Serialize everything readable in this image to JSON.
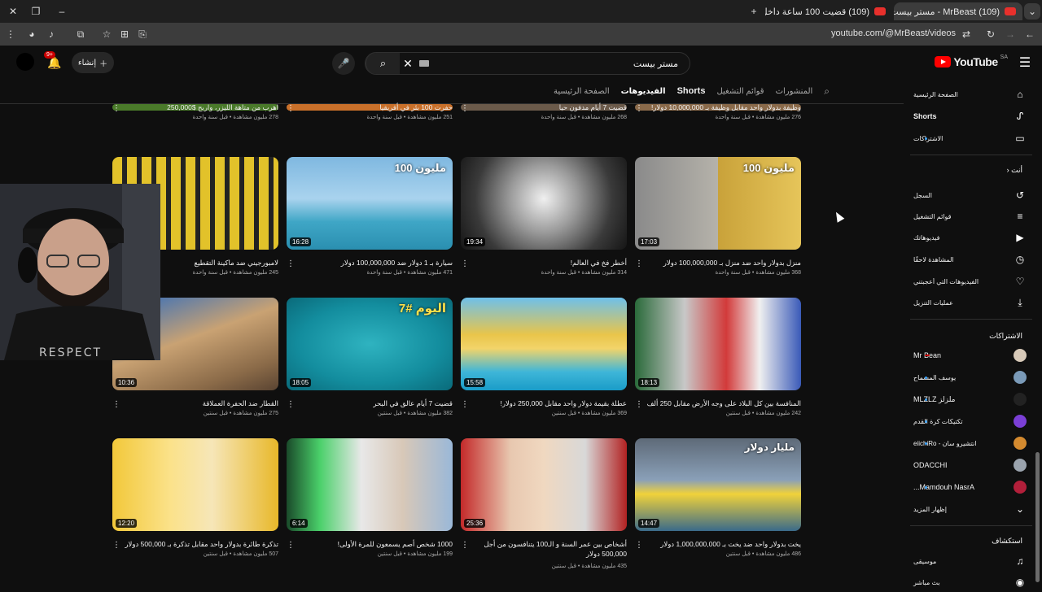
{
  "browser": {
    "tabs": [
      {
        "title": "(109) MrBeast - مستر بيست - Yo",
        "active": true
      },
      {
        "title": "(109) قضيت 100 ساعة داخل الأ",
        "active": false
      }
    ],
    "url": "youtube.com/@MrBeast/videos"
  },
  "masthead": {
    "logo_text": "YouTube",
    "region": "SA",
    "search_value": "مستر بيست",
    "create_label": "إنشاء",
    "notification_count": "9+"
  },
  "channel_tabs": [
    {
      "label": "الصفحة الرئيسية",
      "active": false
    },
    {
      "label": "الفيديوهات",
      "active": true
    },
    {
      "label": "Shorts",
      "active": false
    },
    {
      "label": "قوائم التشغيل",
      "active": false
    },
    {
      "label": "المنشورات",
      "active": false
    }
  ],
  "videos_row0": [
    {
      "title": "وظيفة بدولار واحد مقابل وظيفة بـ 10,000,000 دولار!",
      "meta": "276 مليون مشاهدة • قبل سنة واحدة"
    },
    {
      "title": "قضيت 7 أيام مدفون حيا",
      "meta": "268 مليون مشاهدة • قبل سنة واحدة"
    },
    {
      "title": "حفرت 100 بئر في أفريقيا",
      "meta": "251 مليون مشاهدة • قبل سنة واحدة"
    },
    {
      "title": "اهرب من متاهة الليزر، واربح $250,000",
      "meta": "278 مليون مشاهدة • قبل سنة واحدة"
    }
  ],
  "videos_row1": [
    {
      "title": "منزل بدولار واحد ضد منزل بـ 100,000,000 دولار",
      "meta": "368 مليون مشاهدة • قبل سنة واحدة",
      "duration": "17:03",
      "overlay": "100 مليون"
    },
    {
      "title": "أخطر فخ في العالم!",
      "meta": "314 مليون مشاهدة • قبل سنة واحدة",
      "duration": "19:34",
      "overlay": ""
    },
    {
      "title": "سيارة بـ 1 دولار ضد 100,000,000 دولار",
      "meta": "471 مليون مشاهدة • قبل سنة واحدة",
      "duration": "16:28",
      "overlay": "100 مليون"
    },
    {
      "title": "لامبورجيني ضد ماكينة التقطيع",
      "meta": "245 مليون مشاهدة • قبل سنة واحدة",
      "duration": "",
      "overlay": ""
    }
  ],
  "videos_row2": [
    {
      "title": "المنافسة بين كل البلاد على وجه الأرض مقابل 250 ألف دولار",
      "meta": "242 مليون مشاهدة • قبل سنتين",
      "duration": "18:13",
      "overlay": ""
    },
    {
      "title": "عطلة بقيمة دولار واحد مقابل 250,000 دولار!",
      "meta": "369 مليون مشاهدة • قبل سنتين",
      "duration": "15:58",
      "overlay": ""
    },
    {
      "title": "قضيت 7 أيام عالق في البحر",
      "meta": "382 مليون مشاهدة • قبل سنتين",
      "duration": "18:05",
      "overlay": "اليوم #7"
    },
    {
      "title": "القطار ضد الحفرة العملاقة",
      "meta": "275 مليون مشاهدة • قبل سنتين",
      "duration": "10:36",
      "overlay": ""
    }
  ],
  "videos_row3": [
    {
      "title": "يخت بدولار واحد ضد يخت بـ 1,000,000,000 دولار",
      "meta": "486 مليون مشاهدة • قبل سنتين",
      "duration": "14:47",
      "overlay": "مليار دولار"
    },
    {
      "title": "أشخاص بين عمر السنة و الـ100 يتنافسون من أجل 500,000 دولار",
      "meta": "435 مليون مشاهدة • قبل سنتين",
      "duration": "25:36",
      "overlay": ""
    },
    {
      "title": "1000 شخص أصم يسمعون للمرة الأولى!",
      "meta": "199 مليون مشاهدة • قبل سنتين",
      "duration": "6:14",
      "overlay": ""
    },
    {
      "title": "تذكرة طائرة بدولار واحد مقابل تذكرة بـ 500,000 دولار",
      "meta": "507 مليون مشاهدة • قبل سنتين",
      "duration": "12:20",
      "overlay": ""
    }
  ],
  "sidebar": {
    "main": [
      {
        "label": "الصفحة الرئيسية",
        "icon": "home-icon",
        "glyph": "⌂"
      },
      {
        "label": "Shorts",
        "icon": "shorts-icon",
        "glyph": "ᔑ"
      },
      {
        "label": "الاشتراكات",
        "icon": "subscriptions-icon",
        "glyph": "▭"
      }
    ],
    "you_header": "أنت",
    "you": [
      {
        "label": "السجل",
        "icon": "history-icon",
        "glyph": "↺"
      },
      {
        "label": "قوائم التشغيل",
        "icon": "playlists-icon",
        "glyph": "≡"
      },
      {
        "label": "فيديوهاتك",
        "icon": "your-videos-icon",
        "glyph": "▶"
      },
      {
        "label": "المشاهدة لاحقًا",
        "icon": "watch-later-icon",
        "glyph": "◷"
      },
      {
        "label": "الفيديوهات التي أعجبتني",
        "icon": "like-icon",
        "glyph": "👍"
      },
      {
        "label": "عمليات التنزيل",
        "icon": "download-icon",
        "glyph": "⤓"
      }
    ],
    "subs_header": "الاشتراكات",
    "subs": [
      {
        "label": "Mr Bean",
        "color": "#d7c9b8"
      },
      {
        "label": "يوسف المسماح",
        "color": "#7a9ab8"
      },
      {
        "label": "ملزلز MLZLZ",
        "color": "#222222"
      },
      {
        "label": "تكتيكات كرة القدم",
        "color": "#7b3fd6"
      },
      {
        "label": "انتشيرو سان - eiichiRo",
        "color": "#d48a2f"
      },
      {
        "label": "ODACCHI",
        "color": "#9aa3ad"
      },
      {
        "label": "Mamdouh NasrA...",
        "color": "#b21f3a"
      }
    ],
    "show_more": "إظهار المزيد",
    "explore_header": "استكشاف",
    "explore": [
      {
        "label": "موسيقى",
        "icon": "music-icon",
        "glyph": "♫"
      },
      {
        "label": "بث مباشر",
        "icon": "live-icon",
        "glyph": "◉"
      }
    ]
  },
  "colors": {
    "brand": "#ff0000",
    "accent_dot": "#3ea6ff",
    "background": "#0f0f0f"
  }
}
